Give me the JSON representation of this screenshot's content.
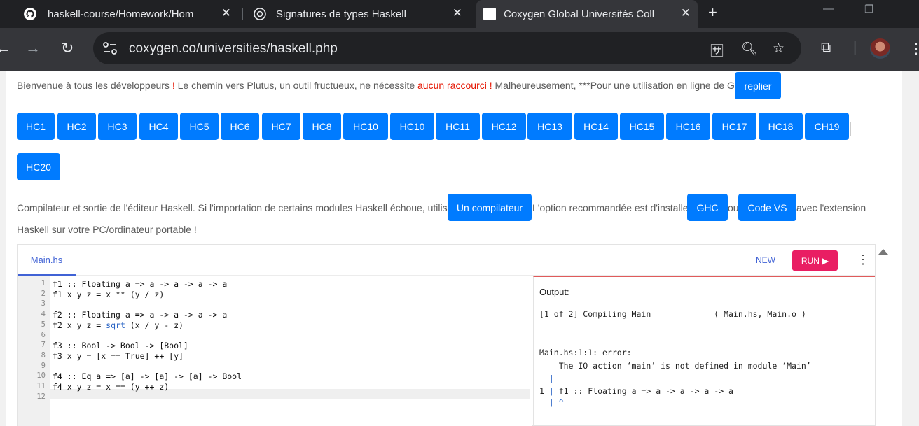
{
  "browser": {
    "tabs": [
      {
        "title": "haskell-course/Homework/Hom",
        "icon": "github-icon"
      },
      {
        "title": "Signatures de types Haskell",
        "icon": "chatgpt-icon"
      },
      {
        "title": "Coxygen Global Universités Coll",
        "icon": "coxygen-icon",
        "active": true
      }
    ],
    "new_tab": "+",
    "url": "coxygen.co/universities/haskell.php"
  },
  "page": {
    "intro": {
      "part1": "Bienvenue à tous les développeurs ",
      "bang1": "!",
      "part2": " Le chemin vers Plutus, un outil fructueux, ne nécessite ",
      "highlight": "aucun raccourci !",
      "part3": " Malheureusement, ***Pour une utilisation en ligne de GHCi",
      "collapse_button": "replier"
    },
    "homework_buttons": [
      "HC1",
      "HC2",
      "HC3",
      "HC4",
      "HC5",
      "HC6",
      "HC7",
      "HC8",
      "HC10",
      "HC10",
      "HC11",
      "HC12",
      "HC13",
      "HC14",
      "HC15",
      "HC16",
      "HC17",
      "HC18",
      "CH19",
      "HC20"
    ],
    "para2": {
      "text1": "Compilateur et sortie de l'éditeur Haskell. Si l'importation de certains modules Haskell échoue, utilisez",
      "btn_compiler": "Un compilateur",
      "text2": "L'option recommandée est d'installer",
      "btn_ghc": "GHC",
      "text3": "ou",
      "btn_vscode": "Code VS",
      "text4": "avec l'extension",
      "line2": "Haskell sur votre PC/ordinateur portable !"
    },
    "editor": {
      "file_tab": "Main.hs",
      "new_label": "NEW",
      "run_label": "RUN",
      "lines": [
        "f1 :: Floating a => a -> a -> a -> a",
        "f1 x y z = x ** (y / z)",
        "",
        "f2 :: Floating a => a -> a -> a -> a",
        "f2 x y z = sqrt (x / y - z)",
        "",
        "f3 :: Bool -> Bool -> [Bool]",
        "f3 x y = [x == True] ++ [y]",
        "",
        "f4 :: Eq a => [a] -> [a] -> [a] -> Bool",
        "f4 x y z = x == (y ++ z)",
        ""
      ],
      "line_numbers": [
        "1",
        "2",
        "3",
        "4",
        "5",
        "6",
        "7",
        "8",
        "9",
        "10",
        "11",
        "12"
      ],
      "active_line": 12,
      "output": {
        "label": "Output:",
        "compile_line": "[1 of 2] Compiling Main             ( Main.hs, Main.o )",
        "error_line": "Main.hs:1:1: error:",
        "error_msg": "    The IO action ‘main’ is not defined in module ‘Main’",
        "pipe1": "  |",
        "src_line_num": "1",
        "src_line": " f1 :: Floating a => a -> a -> a -> a",
        "caret": "  | ^"
      }
    }
  }
}
